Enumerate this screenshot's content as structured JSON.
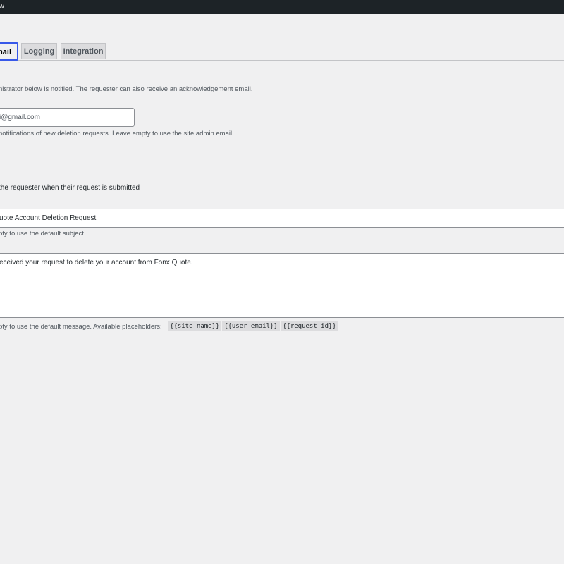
{
  "topbar": {
    "title": "w"
  },
  "tabs": [
    {
      "label": "mail"
    },
    {
      "label": "Logging"
    },
    {
      "label": "Integration"
    }
  ],
  "intro_text": "nistrator below is notified. The requester can also receive an acknowledgement email.",
  "notification_email": {
    "value": "i@gmail.com",
    "description": "notifications of new deletion requests. Leave empty to use the site admin email."
  },
  "ack_option": {
    "label": "the requester when their request is submitted"
  },
  "subject": {
    "value": "uote Account Deletion Request",
    "description": "pty to use the default subject."
  },
  "message": {
    "value": "eceived your request to delete your account from Fonx Quote.",
    "description": "pty to use the default message. Available placeholders:",
    "placeholders": [
      "{{site_name}}",
      "{{user_email}}",
      "{{request_id}}"
    ]
  }
}
